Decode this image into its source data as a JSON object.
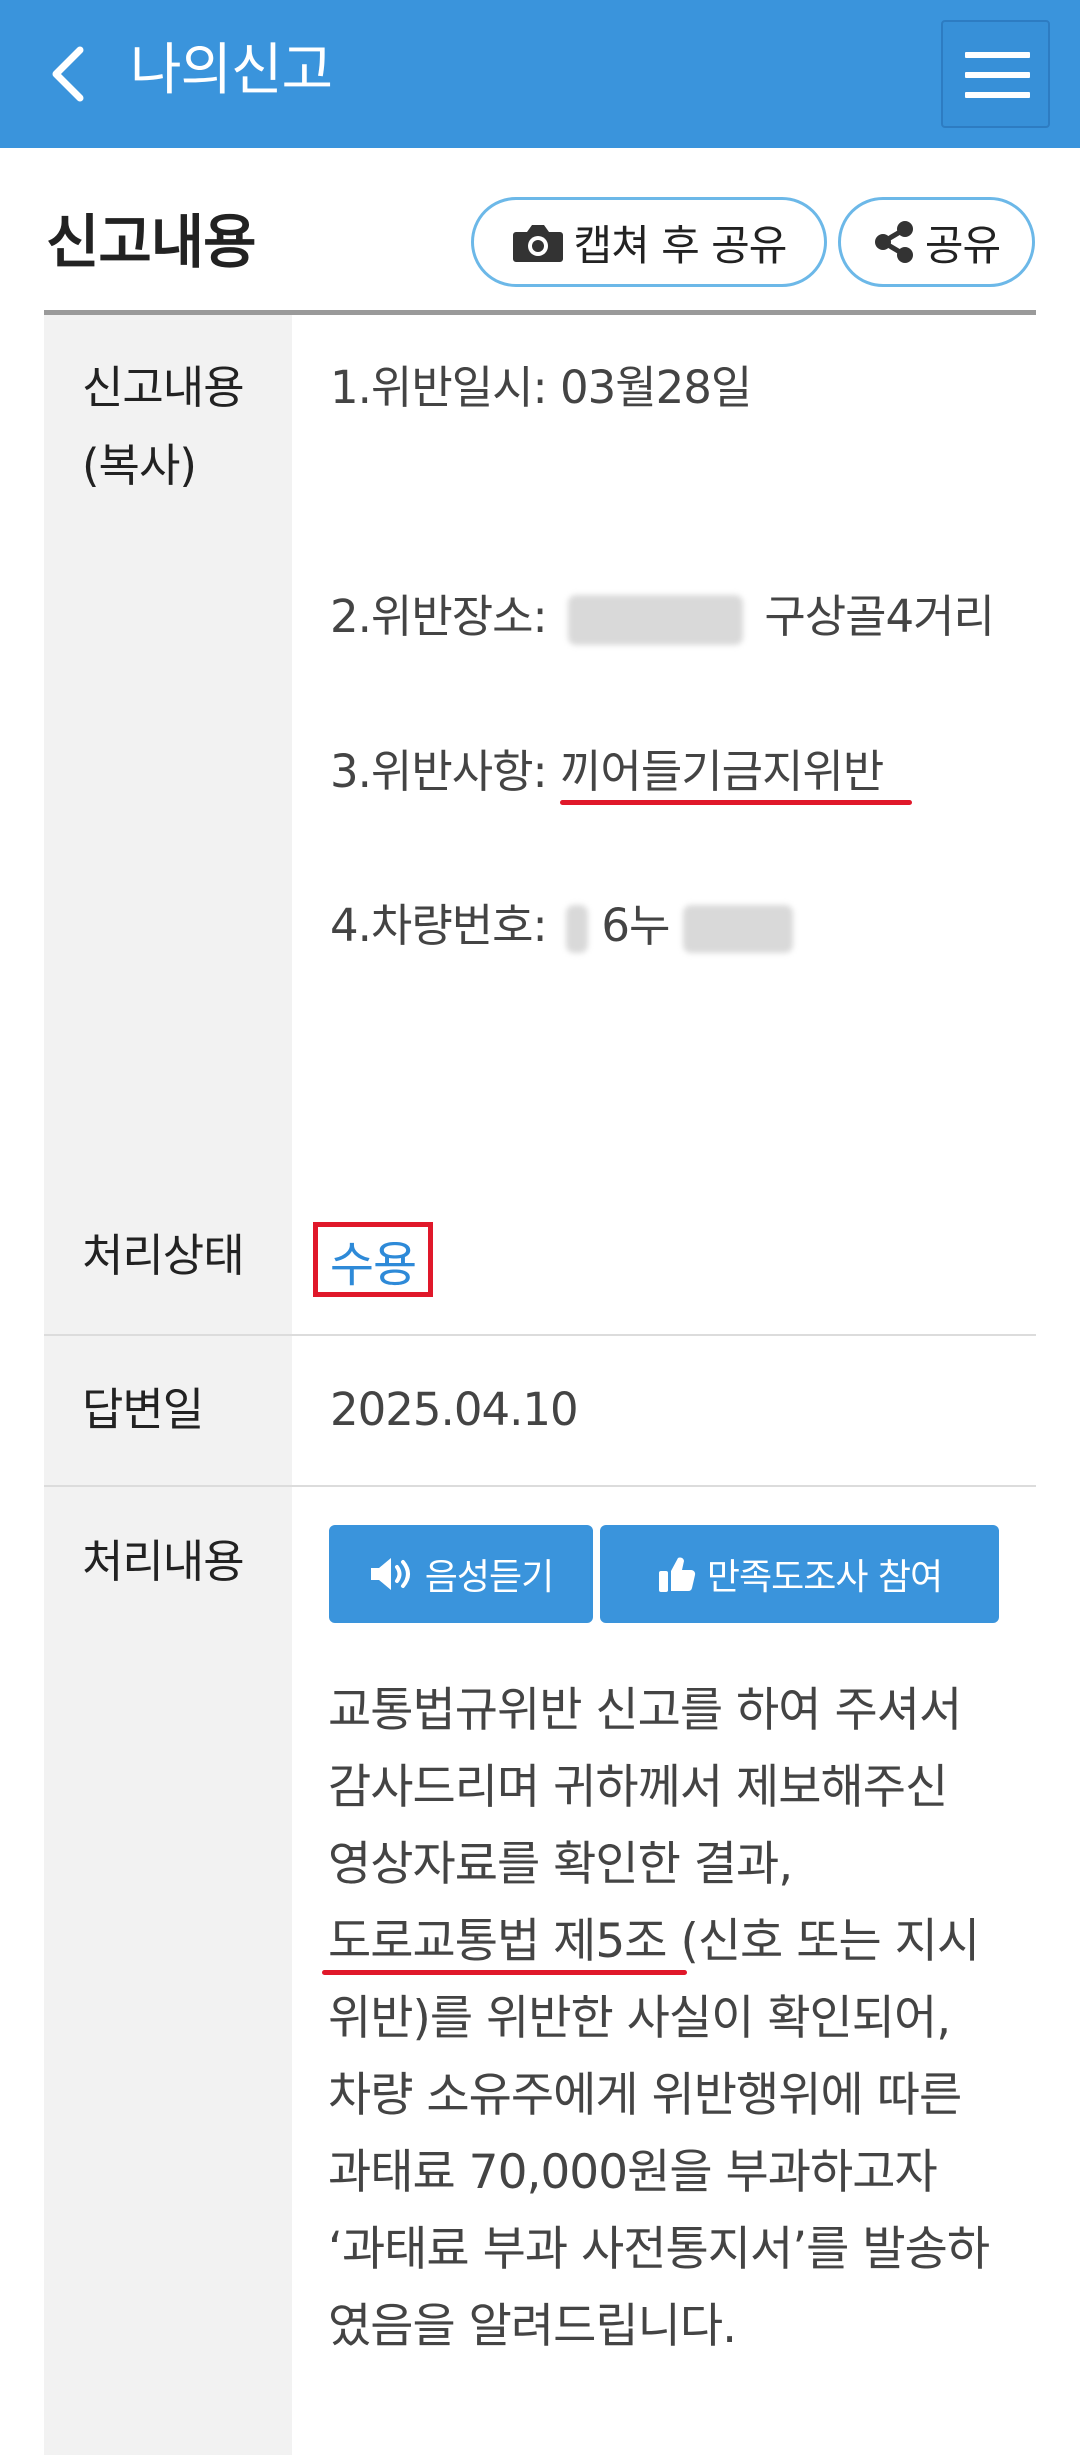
{
  "header": {
    "title": "나의신고",
    "back_icon": "chevron-left-icon",
    "menu_icon": "hamburger-menu-icon"
  },
  "section": {
    "title": "신고내용",
    "capture_share_label": "캡쳐 후 공유",
    "share_label": "공유"
  },
  "report": {
    "label_line1": "신고내용",
    "label_line2": "(복사)",
    "item1": "1.위반일시: 03월28일",
    "item2_prefix": "2.위반장소:",
    "item2_suffix": "구상골4거리",
    "item3_prefix": "3.위반사항:",
    "item3_highlight": "끼어들기금지위반",
    "item4_prefix": "4.차량번호:",
    "item4_visible": "6누"
  },
  "status": {
    "label": "처리상태",
    "value": "수용"
  },
  "answer_date": {
    "label": "답변일",
    "value": "2025.04.10"
  },
  "result": {
    "label": "처리내용",
    "voice_button": "음성듣기",
    "survey_button": "만족도조사 참여",
    "lines": [
      "교통법규위반 신고를 하여 주셔서",
      "감사드리며 귀하께서 제보해주신",
      "영상자료를 확인한 결과,",
      "(신호 또는 지시",
      "위반)를 위반한 사실이 확인되어,",
      "차량 소유주에게 위반행위에 따른",
      "과태료 70,000원을 부과하고자",
      "‘과태료 부과 사전통지서’를 발송하",
      "였음을 알려드립니다."
    ],
    "law_highlight": "도로교통법 제5조"
  },
  "colors": {
    "primary": "#3a94dc",
    "highlight_red": "#e0182a",
    "status_blue": "#2e8ad8"
  }
}
